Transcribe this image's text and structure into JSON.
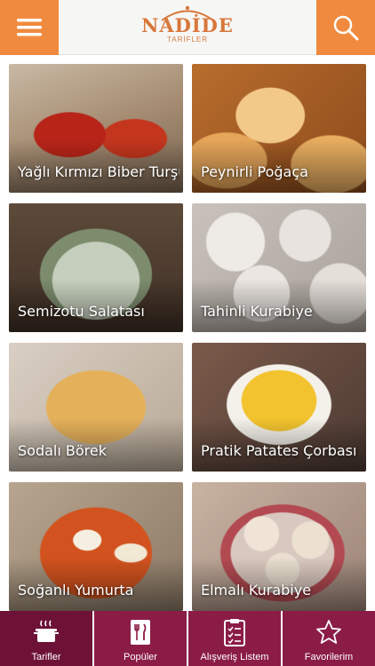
{
  "header": {
    "logo_top": "NADİDE",
    "logo_bottom": "TARİFLER",
    "menu_icon": "hamburger-menu-icon",
    "search_icon": "search-icon",
    "accent_color": "#f08a3e"
  },
  "recipes": [
    {
      "title": "Yağlı Kırmızı Biber Turşusu"
    },
    {
      "title": "Peynirli Poğaça"
    },
    {
      "title": "Semizotu Salatası"
    },
    {
      "title": "Tahinli Kurabiye"
    },
    {
      "title": "Sodalı Börek"
    },
    {
      "title": "Pratik Patates Çorbası"
    },
    {
      "title": "Soğanlı Yumurta"
    },
    {
      "title": "Elmalı Kurabiye"
    }
  ],
  "tabbar": {
    "color": "#8a1c45",
    "tabs": [
      {
        "label": "Tarifler",
        "icon": "cooking-pot-icon"
      },
      {
        "label": "Popüler",
        "icon": "fork-knife-book-icon"
      },
      {
        "label": "Alışveriş Listem",
        "icon": "checklist-icon"
      },
      {
        "label": "Favorilerim",
        "icon": "star-icon"
      }
    ]
  }
}
